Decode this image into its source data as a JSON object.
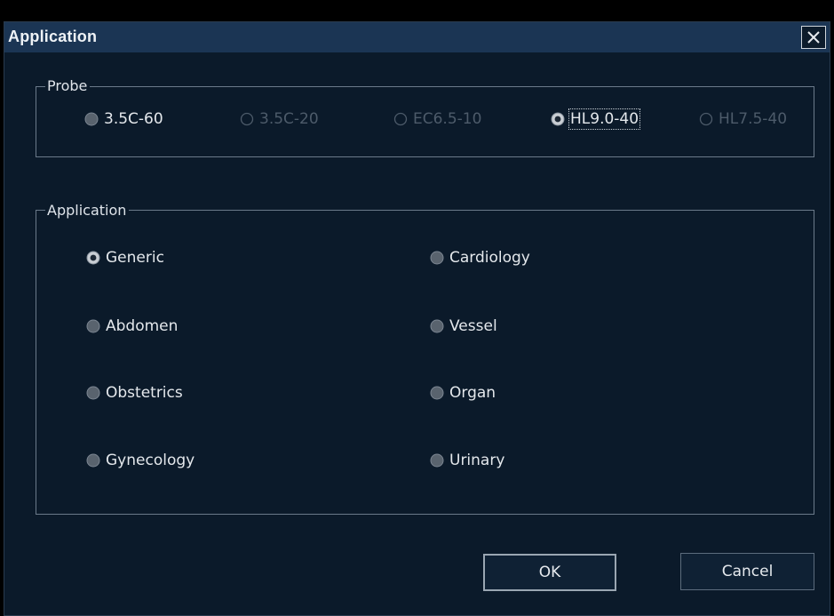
{
  "dialog": {
    "title": "Application",
    "close_icon": "close-x-icon"
  },
  "probe": {
    "label": "Probe",
    "options": [
      {
        "label": "3.5C-60",
        "selected": false,
        "enabled": true
      },
      {
        "label": "3.5C-20",
        "selected": false,
        "enabled": false
      },
      {
        "label": "EC6.5-10",
        "selected": false,
        "enabled": false
      },
      {
        "label": "HL9.0-40",
        "selected": true,
        "enabled": true,
        "focused": true
      },
      {
        "label": "HL7.5-40",
        "selected": false,
        "enabled": false
      }
    ]
  },
  "application": {
    "label": "Application",
    "options": [
      {
        "label": "Generic",
        "selected": true
      },
      {
        "label": "Cardiology",
        "selected": false
      },
      {
        "label": "Abdomen",
        "selected": false
      },
      {
        "label": "Vessel",
        "selected": false
      },
      {
        "label": "Obstetrics",
        "selected": false
      },
      {
        "label": "Organ",
        "selected": false
      },
      {
        "label": "Gynecology",
        "selected": false
      },
      {
        "label": "Urinary",
        "selected": false
      }
    ]
  },
  "buttons": {
    "ok_label": "OK",
    "cancel_label": "Cancel"
  },
  "colors": {
    "window_bg": "#0b1a2a",
    "titlebar_bg": "#1b3554",
    "text": "#e4e8ec",
    "disabled_text": "#4d5b6a",
    "frame": "#6b7a8a"
  }
}
